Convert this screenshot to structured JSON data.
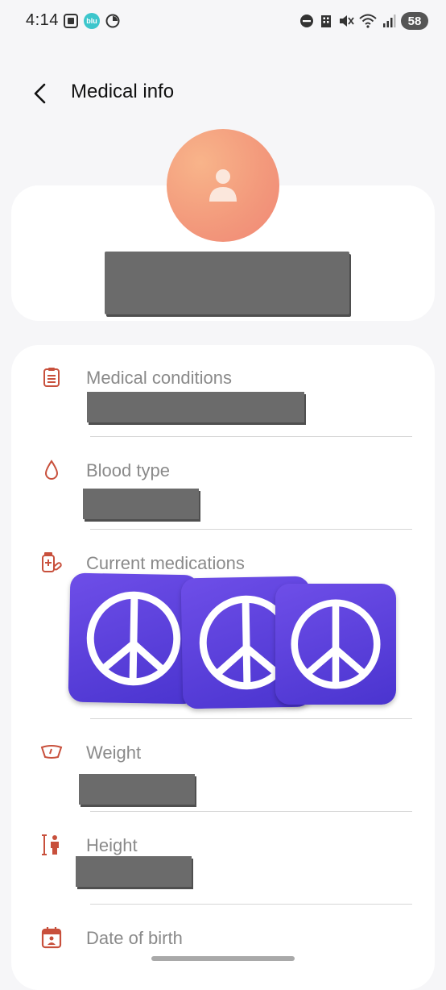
{
  "status_bar": {
    "time": "4:14",
    "blu_badge": "blu",
    "battery_level": "58"
  },
  "app_bar": {
    "title": "Medical info"
  },
  "profile": {
    "name_redacted": true
  },
  "rows": [
    {
      "label": "Medical conditions",
      "icon": "clipboard-icon"
    },
    {
      "label": "Blood type",
      "icon": "droplet-icon"
    },
    {
      "label": "Current medications",
      "icon": "medication-icon"
    },
    {
      "label": "Weight",
      "icon": "scale-icon"
    },
    {
      "label": "Height",
      "icon": "height-icon"
    },
    {
      "label": "Date of birth",
      "icon": "calendar-icon"
    }
  ],
  "colors": {
    "accent_icon": "#c8503c",
    "label_gray": "#8a8a8a",
    "redaction": "#6b6b6b",
    "sticker_purple": "#5a3ee0"
  }
}
